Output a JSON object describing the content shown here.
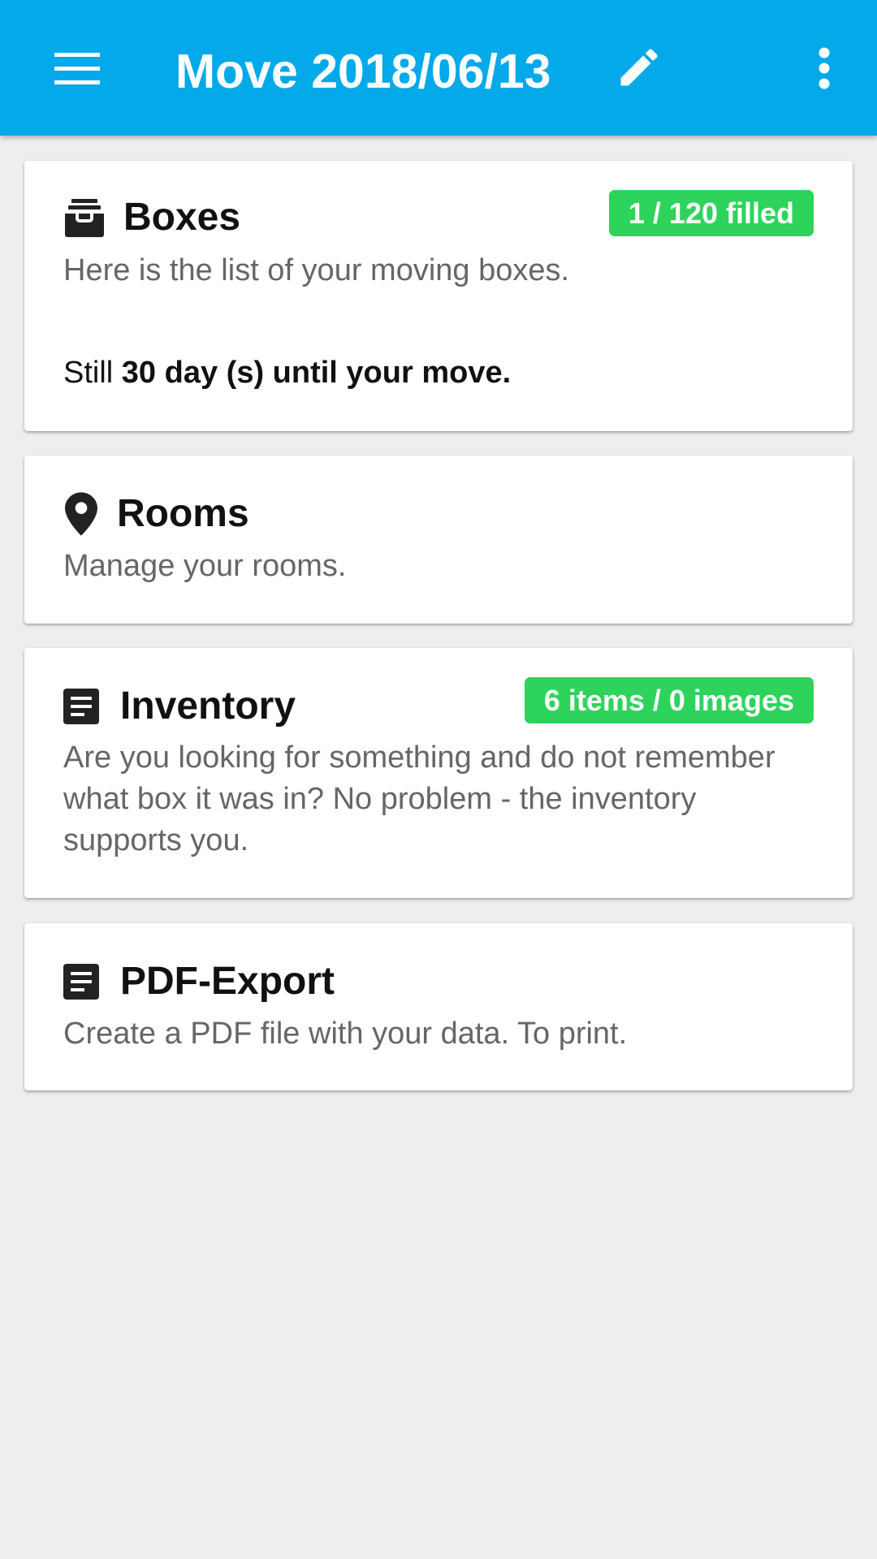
{
  "appbar": {
    "title": "Move 2018/06/13",
    "menu_icon": "menu-icon",
    "edit_icon": "pencil-icon",
    "overflow_icon": "more-vert-icon",
    "color": "#03a9e8"
  },
  "cards": [
    {
      "title": "Boxes",
      "icon": "archive-box-icon",
      "description": "Here is the list of your moving boxes.",
      "badge": "1 / 120 filled",
      "countdown_prefix": "Still ",
      "countdown_bold": "30 day (s) until your move."
    },
    {
      "title": "Rooms",
      "icon": "location-pin-icon",
      "description": "Manage your rooms."
    },
    {
      "title": "Inventory",
      "icon": "document-list-icon",
      "description": "Are you looking for something and do not remember what box it was in? No problem - the inventory supports you.",
      "badge": "6 items / 0 images"
    },
    {
      "title": "PDF-Export",
      "icon": "document-list-icon",
      "description": "Create a PDF file with your data. To print."
    }
  ],
  "colors": {
    "badge": "#2ed35c",
    "background": "#eeeeee"
  }
}
